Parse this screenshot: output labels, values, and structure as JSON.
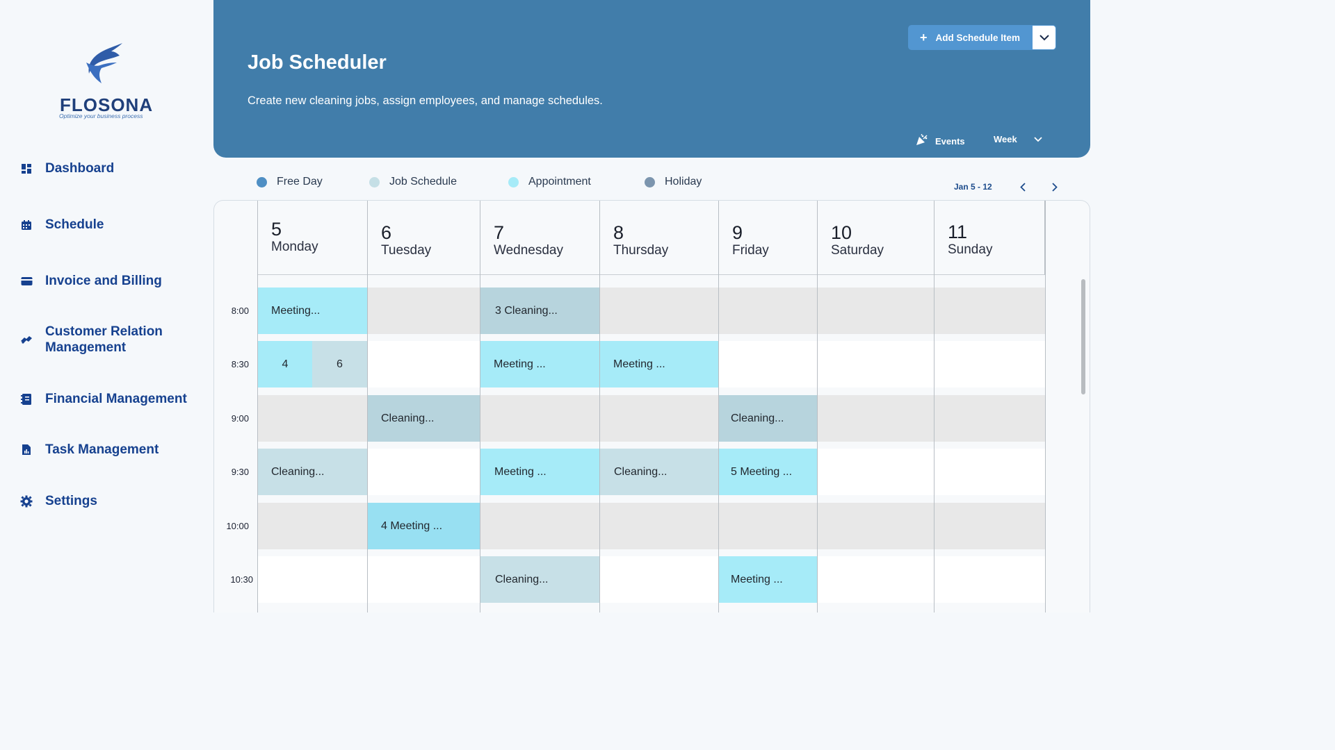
{
  "brand": {
    "name": "FLOSONA",
    "tagline": "Optimize your business process",
    "color": "#1f3f7a"
  },
  "sidebar": {
    "items": [
      {
        "label": "Dashboard",
        "icon": "dashboard-icon"
      },
      {
        "label": "Schedule",
        "icon": "calendar-icon"
      },
      {
        "label": "Invoice and Billing",
        "icon": "card-icon"
      },
      {
        "label": "Customer Relation Management",
        "icon": "handshake-icon"
      },
      {
        "label": "Financial Management",
        "icon": "ledger-icon"
      },
      {
        "label": "Task Management",
        "icon": "report-icon"
      },
      {
        "label": "Settings",
        "icon": "gear-icon"
      }
    ]
  },
  "header": {
    "title": "Job Scheduler",
    "subtitle": "Create new cleaning jobs, assign employees, and manage schedules.",
    "add_button": "Add Schedule Item",
    "events_label": "Events",
    "view_label": "Week",
    "background": "#417daa"
  },
  "legend": [
    {
      "label": "Free Day",
      "color": "#4f8fc4"
    },
    {
      "label": "Job Schedule",
      "color": "#c5dfe6"
    },
    {
      "label": "Appointment",
      "color": "#a6ebf8"
    },
    {
      "label": "Holiday",
      "color": "#7c95ae"
    }
  ],
  "calendar": {
    "range": "Jan 5 - 12",
    "days": [
      {
        "num": "5",
        "name": "Monday"
      },
      {
        "num": "6",
        "name": "Tuesday"
      },
      {
        "num": "7",
        "name": "Wednesday"
      },
      {
        "num": "8",
        "name": "Thursday"
      },
      {
        "num": "9",
        "name": "Friday"
      },
      {
        "num": "10",
        "name": "Saturday"
      },
      {
        "num": "11",
        "name": "Sunday"
      }
    ],
    "times": [
      "8:00",
      "8:30",
      "9:00",
      "9:30",
      "10:00",
      "10:30"
    ],
    "events": [
      {
        "day": 0,
        "row": 0,
        "text": "Meeting...",
        "kind": "appointment"
      },
      {
        "day": 2,
        "row": 0,
        "text": "3 Cleaning...",
        "kind": "job-dark"
      },
      {
        "day": 0,
        "row": 1,
        "text": "4",
        "kind": "appointment",
        "half": "left"
      },
      {
        "day": 0,
        "row": 1,
        "text": "6",
        "kind": "job",
        "half": "right"
      },
      {
        "day": 2,
        "row": 1,
        "text": "Meeting ...",
        "kind": "appointment"
      },
      {
        "day": 3,
        "row": 1,
        "text": "Meeting ...",
        "kind": "appointment"
      },
      {
        "day": 1,
        "row": 2,
        "text": "Cleaning...",
        "kind": "job-dark"
      },
      {
        "day": 4,
        "row": 2,
        "text": "Cleaning...",
        "kind": "job-dark"
      },
      {
        "day": 0,
        "row": 3,
        "text": "Cleaning...",
        "kind": "job"
      },
      {
        "day": 2,
        "row": 3,
        "text": "Meeting ...",
        "kind": "appointment"
      },
      {
        "day": 3,
        "row": 3,
        "text": "Cleaning...",
        "kind": "job"
      },
      {
        "day": 4,
        "row": 3,
        "text": "5 Meeting ...",
        "kind": "appointment"
      },
      {
        "day": 1,
        "row": 4,
        "text": "4 Meeting ...",
        "kind": "appointment-dark"
      },
      {
        "day": 2,
        "row": 5,
        "text": "Cleaning...",
        "kind": "job"
      },
      {
        "day": 4,
        "row": 5,
        "text": "Meeting ...",
        "kind": "appointment"
      }
    ],
    "colors": {
      "appointment": "#a6ebf8",
      "appointment-dark": "#98e0f2",
      "job": "#c7e0e7",
      "job-dark": "#b7d4dd",
      "band_grey": "#e8e8e8",
      "band_white": "#ffffff"
    }
  }
}
